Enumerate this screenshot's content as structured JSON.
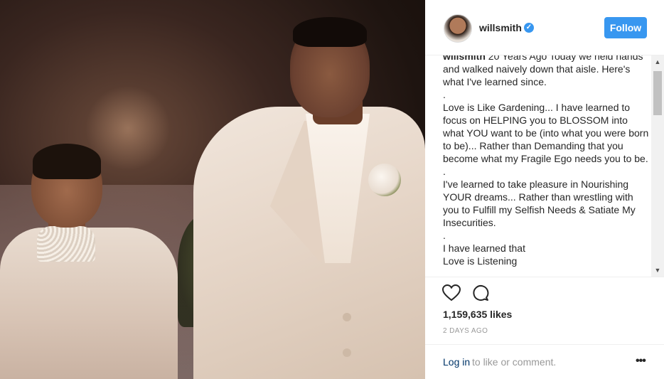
{
  "post": {
    "photo_alt_icon": "wedding-photo",
    "username": "willsmith",
    "verified_badge": "✓",
    "follow_label": "Follow",
    "caption_user": "willsmith",
    "caption_lines": [
      "20 Years Ago Today we held hands and walked naively down that aisle. Here's what I've learned since.",
      ".",
      "Love is Like Gardening... I have learned to focus on HELPING you to BLOSSOM into what YOU want to be (into what you were born to be)... Rather than Demanding that you become what my Fragile Ego needs you to be.",
      ".",
      "I've learned to take pleasure in Nourishing YOUR dreams... Rather than wrestling with you to Fulfill my Selfish Needs & Satiate My Insecurities.",
      ".",
      "I have learned that",
      "Love is Listening"
    ],
    "likes": "1,159,635 likes",
    "timestamp": "2 DAYS AGO",
    "login_link": "Log in",
    "login_rest": "to like or comment.",
    "more_icon_glyph": "•••"
  },
  "icons": {
    "heart": "heart-icon",
    "comment": "comment-icon",
    "more": "more-options-icon",
    "scroll_up": "▲",
    "scroll_down": "▼"
  },
  "colors": {
    "accent": "#3897f0",
    "link": "#003569",
    "muted": "#999999"
  }
}
